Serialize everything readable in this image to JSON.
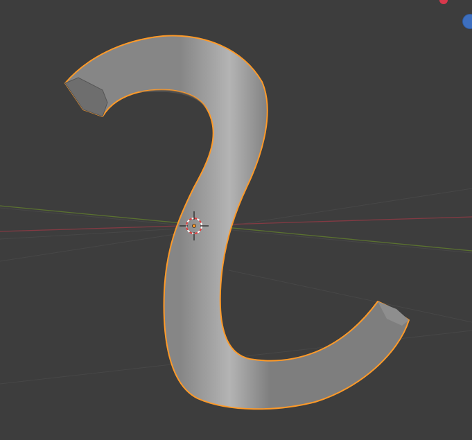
{
  "viewport": {
    "name": "3D Viewport",
    "background_color": "#3d3d3d",
    "grid_color": "#484848",
    "x_axis_color": "#833a43",
    "y_axis_color": "#5b7230"
  },
  "object": {
    "type": "curve-tube",
    "selected": true,
    "selection_outline_color": "#ff9a28",
    "body_color": "#9b9b9b"
  },
  "cursor_3d": {
    "icon": "3d-cursor-icon",
    "ring_colors": [
      "#e33b3b",
      "#ffffff"
    ]
  },
  "origin_dot": {
    "color": "#ff9a28"
  },
  "navigation_gizmo": {
    "x_axis_color": "#d8384c",
    "z_axis_color": "#3d6fbf"
  }
}
